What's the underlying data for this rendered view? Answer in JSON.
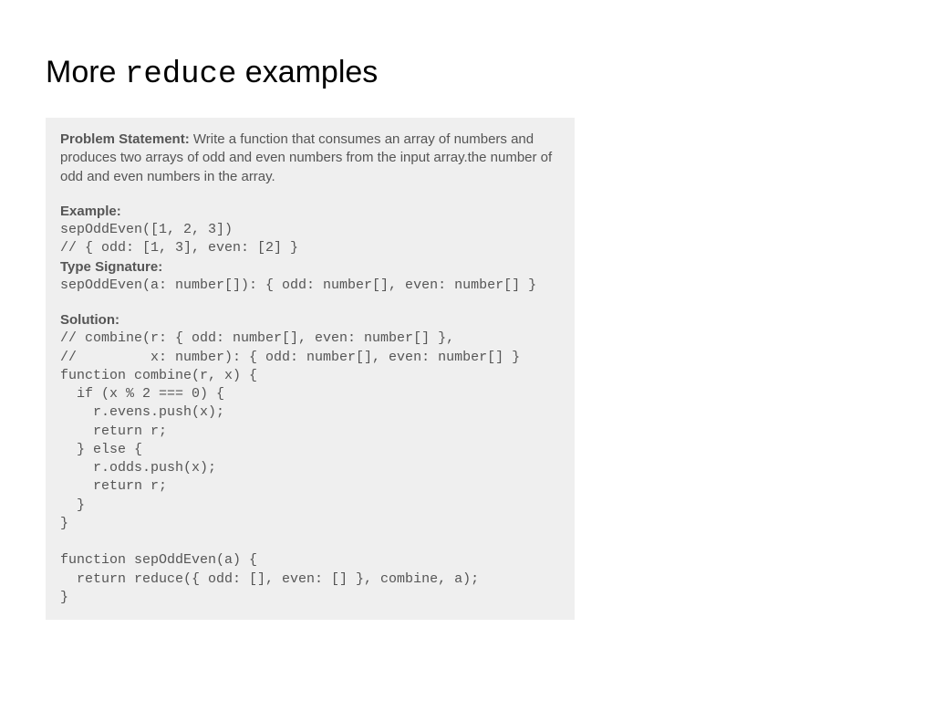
{
  "title": {
    "pre": "More ",
    "code": "reduce",
    "post": " examples"
  },
  "problem": {
    "label": "Problem Statement:",
    "text": " Write a function that consumes an array of numbers and produces two arrays of odd and even numbers from the input array.the number of odd and even numbers in the array."
  },
  "example": {
    "label": "Example:",
    "line1": "sepOddEven([1, 2, 3])",
    "line2": "// { odd: [1, 3], even: [2] }"
  },
  "typesig": {
    "label": "Type Signature:",
    "line": "sepOddEven(a: number[]): { odd: number[], even: number[] }"
  },
  "solution": {
    "label": "Solution:",
    "code": "// combine(r: { odd: number[], even: number[] },\n//         x: number): { odd: number[], even: number[] }\nfunction combine(r, x) {\n  if (x % 2 === 0) {\n    r.evens.push(x);\n    return r;\n  } else {\n    r.odds.push(x);\n    return r;\n  }\n}\n\nfunction sepOddEven(a) {\n  return reduce({ odd: [], even: [] }, combine, a);\n}"
  }
}
